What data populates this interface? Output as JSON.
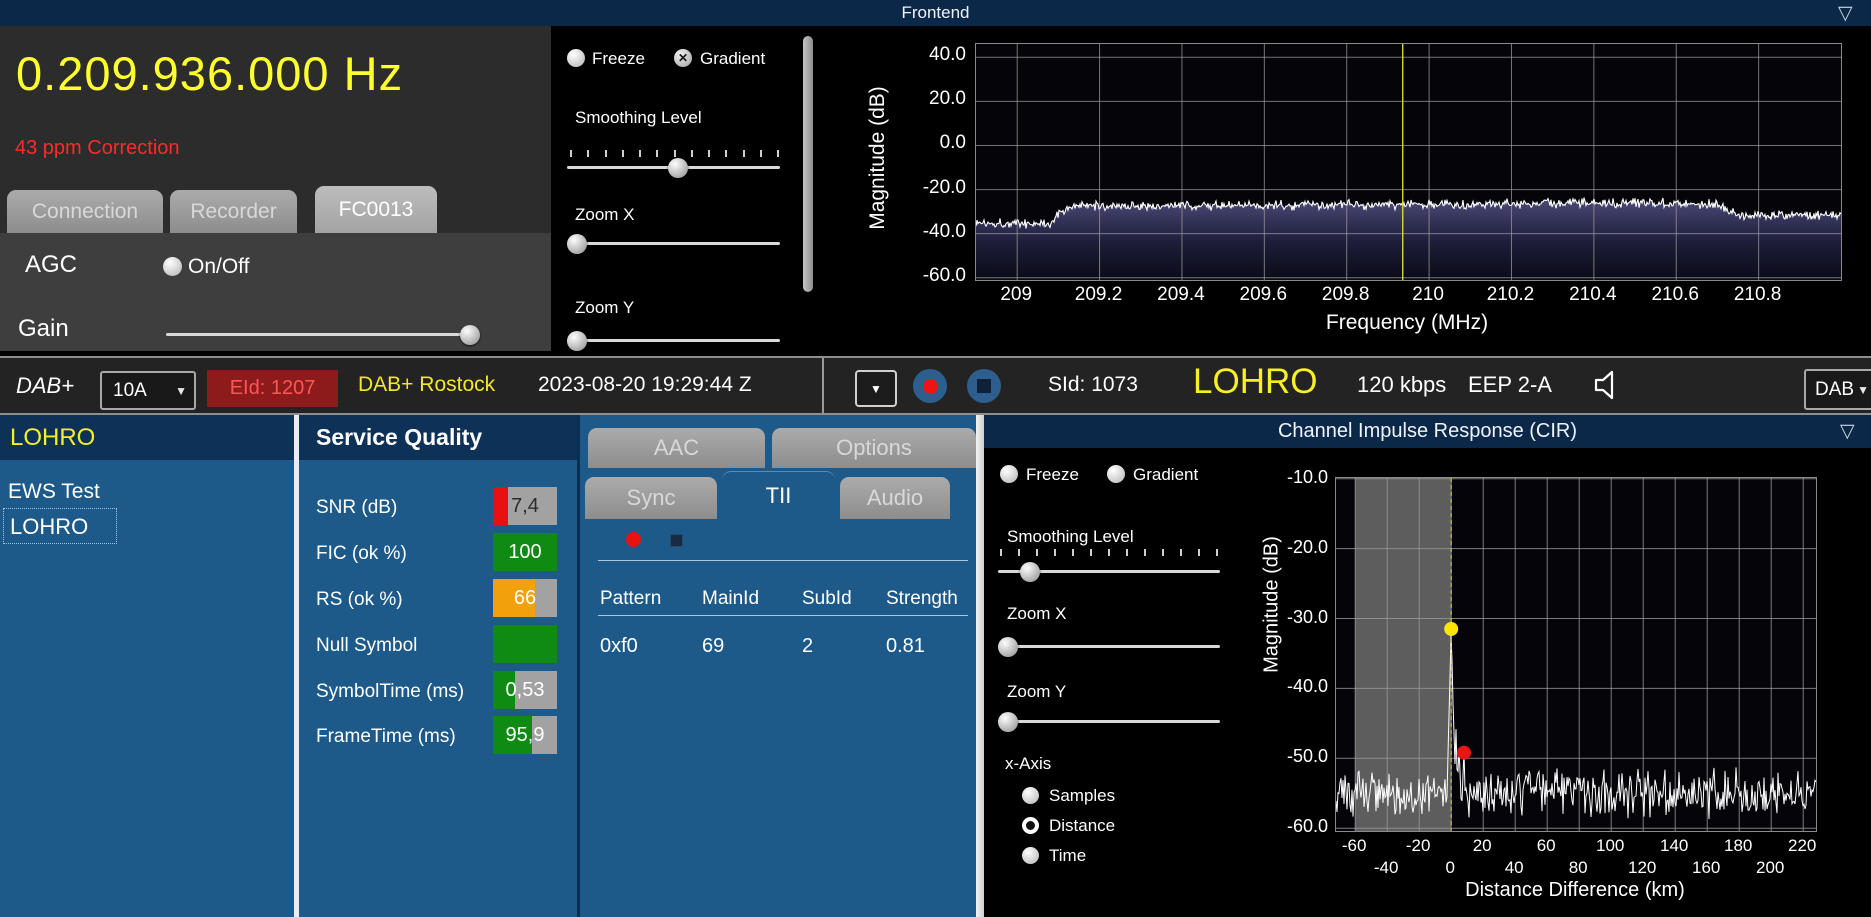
{
  "frontend": {
    "title": "Frontend",
    "collapse_icon": "▽",
    "frequency": "0.209.936.000 Hz",
    "correction": "43 ppm Correction",
    "tabs": [
      {
        "label": "Connection",
        "active": false
      },
      {
        "label": "Recorder",
        "active": false
      },
      {
        "label": "FC0013",
        "active": true
      }
    ],
    "agc_label": "AGC",
    "agc_toggle_label": "On/Off",
    "gain_label": "Gain",
    "controls": {
      "freeze_label": "Freeze",
      "gradient_label": "Gradient",
      "gradient_icon": "✕",
      "smoothing_label": "Smoothing Level",
      "zoom_x_label": "Zoom X",
      "zoom_y_label": "Zoom Y"
    }
  },
  "statusbar": {
    "mode": "DAB+",
    "channel": "10A",
    "eid": "EId: 1207",
    "ensemble": "DAB+ Rostock",
    "datetime": "2023-08-20  19:29:44 Z",
    "sid": "SId: 1073",
    "service": "LOHRO",
    "bitrate": "120 kbps",
    "protection": "EEP 2-A",
    "output_combo": "DAB",
    "combo_arrow": "▼"
  },
  "service_list": {
    "header": "LOHRO",
    "items": [
      "EWS Test",
      "LOHRO"
    ],
    "selected": "LOHRO"
  },
  "quality": {
    "header": "Service Quality",
    "rows": [
      {
        "label": "SNR (dB)",
        "value": "7,4",
        "pct": 23,
        "color": "#e81010",
        "text_color": "#2b2b2b"
      },
      {
        "label": "FIC (ok %)",
        "value": "100",
        "pct": 100,
        "color": "#0f8a12",
        "text_color": "#ffffff"
      },
      {
        "label": "RS (ok %)",
        "value": "66",
        "pct": 66,
        "color": "#f2a10c",
        "text_color": "#ffffff"
      },
      {
        "label": "Null Symbol",
        "value": "",
        "pct": 100,
        "color": "#0f8a12",
        "text_color": "#ffffff"
      },
      {
        "label": "SymbolTime (ms)",
        "value": "0,53",
        "pct": 34,
        "color": "#0f8a12",
        "text_color": "#ffffff"
      },
      {
        "label": "FrameTime (ms)",
        "value": "95,9",
        "pct": 61,
        "color": "#0f8a12",
        "text_color": "#ffffff"
      }
    ]
  },
  "tii": {
    "tabs_row1": [
      "AAC",
      "Options"
    ],
    "tabs_row2": [
      "Sync",
      "TII",
      "Audio"
    ],
    "active_tab": "TII",
    "columns": [
      "Pattern",
      "MainId",
      "SubId",
      "Strength"
    ],
    "rows": [
      [
        "0xf0",
        "69",
        "2",
        "0.81"
      ]
    ]
  },
  "cir": {
    "title": "Channel Impulse Response (CIR)",
    "collapse_icon": "▽",
    "controls": {
      "freeze_label": "Freeze",
      "gradient_label": "Gradient",
      "smoothing_label": "Smoothing Level",
      "zoom_x_label": "Zoom X",
      "zoom_y_label": "Zoom Y",
      "x_axis_label": "x-Axis",
      "x_axis_options": [
        "Samples",
        "Distance",
        "Time"
      ],
      "x_axis_selected": "Distance"
    }
  },
  "chart_data": [
    {
      "id": "frontend_spectrum",
      "type": "area",
      "title": "Frontend",
      "xlabel": "Frequency (MHz)",
      "ylabel": "Magnitude (dB)",
      "xlim": [
        208.9,
        211.0
      ],
      "ylim": [
        -61,
        46
      ],
      "xtick_values": [
        209,
        209.2,
        209.4,
        209.6,
        209.8,
        210,
        210.2,
        210.4,
        210.6,
        210.8
      ],
      "xtick_labels": [
        "209",
        "209.2",
        "209.4",
        "209.6",
        "209.8",
        "210",
        "210.2",
        "210.4",
        "210.6",
        "210.8"
      ],
      "ytick_values": [
        40,
        20,
        0,
        -20,
        -40,
        -60
      ],
      "ytick_labels": [
        "40.0",
        "20.0",
        "0.0",
        "-20.0",
        "-40.0",
        "-60.0"
      ],
      "grid": true,
      "cursor_mhz": 209.936,
      "noise_db": 1.8,
      "envelope": [
        [
          208.9,
          -35.0
        ],
        [
          209.08,
          -35.5
        ],
        [
          209.1,
          -31.0
        ],
        [
          209.13,
          -27.5
        ],
        [
          209.8,
          -27.0
        ],
        [
          210.55,
          -25.8
        ],
        [
          210.7,
          -26.5
        ],
        [
          210.75,
          -31.5
        ],
        [
          211.0,
          -31.8
        ]
      ]
    },
    {
      "id": "cir",
      "type": "line",
      "title": "Channel Impulse Response (CIR)",
      "xlabel": "Distance Difference (km)",
      "ylabel": "Magnitude (dB)",
      "xlim": [
        -72,
        228
      ],
      "ylim": [
        -60.4,
        -9.9
      ],
      "xticks_row1_values": [
        -60,
        -20,
        20,
        60,
        100,
        140,
        180,
        220
      ],
      "xticks_row1_labels": [
        "-60",
        "-20",
        "20",
        "60",
        "100",
        "140",
        "180",
        "220"
      ],
      "xticks_row2_values": [
        -40,
        0,
        40,
        80,
        120,
        160,
        200
      ],
      "xticks_row2_labels": [
        "-40",
        "0",
        "40",
        "80",
        "120",
        "160",
        "200"
      ],
      "ytick_values": [
        -10,
        -20,
        -30,
        -40,
        -50,
        -60
      ],
      "ytick_labels": [
        "-10.0",
        "-20.0",
        "-30.0",
        "-40.0",
        "-50.0",
        "-60.0"
      ],
      "grid": true,
      "shaded_region_km": [
        -60,
        0
      ],
      "cursor_km": 0,
      "baseline_db": -55,
      "noise_db": 2.6,
      "spikes": [
        [
          0,
          -31.5
        ],
        [
          1.5,
          -44
        ],
        [
          3,
          -45.5
        ],
        [
          5,
          -47.5
        ],
        [
          8,
          -49.0
        ],
        [
          12,
          -51.5
        ]
      ],
      "markers": [
        {
          "x": 0,
          "y": -31.5,
          "color": "#ffe400"
        },
        {
          "x": 8,
          "y": -49.2,
          "color": "#e81616"
        }
      ]
    }
  ]
}
